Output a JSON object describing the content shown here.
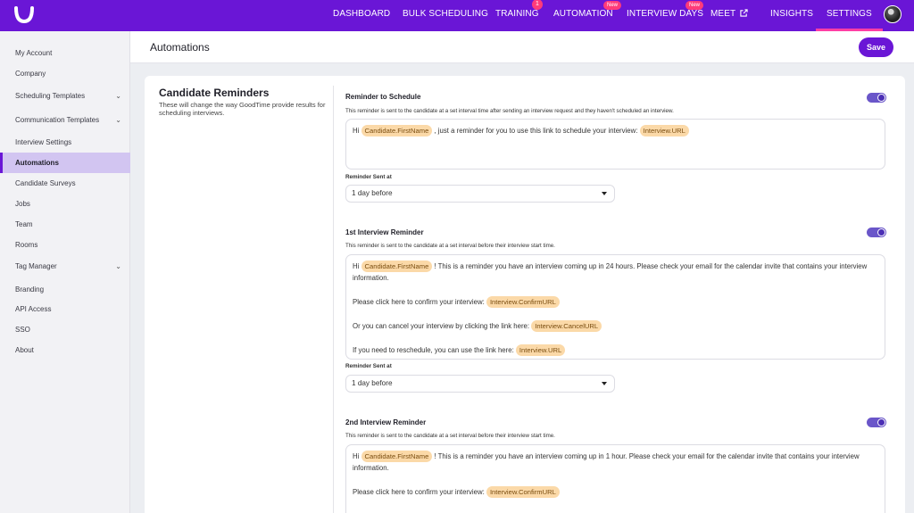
{
  "nav": {
    "items": [
      "DASHBOARD",
      "BULK SCHEDULING",
      "TRAINING",
      "AUTOMATION",
      "INTERVIEW DAYS",
      "MEET",
      "INSIGHTS",
      "SETTINGS"
    ],
    "training_badge": "1",
    "new_badge": "New",
    "active": "SETTINGS"
  },
  "sidebar": {
    "items": [
      {
        "label": "My Account"
      },
      {
        "label": "Company"
      },
      {
        "label": "Scheduling Templates"
      },
      {
        "label": "Communication Templates"
      },
      {
        "label": "Interview Settings"
      },
      {
        "label": "Automations"
      },
      {
        "label": "Candidate Surveys"
      },
      {
        "label": "Jobs"
      },
      {
        "label": "Team"
      },
      {
        "label": "Rooms"
      },
      {
        "label": "Tag Manager"
      },
      {
        "label": "Branding"
      },
      {
        "label": "API Access"
      },
      {
        "label": "SSO"
      },
      {
        "label": "About"
      }
    ]
  },
  "header": {
    "title": "Automations",
    "save_label": "Save"
  },
  "card": {
    "title": "Candidate Reminders",
    "description": "These will change the way GoodTime provide results for scheduling interviews."
  },
  "sections": [
    {
      "title": "Reminder to Schedule",
      "description": "This reminder is sent to the candidate at a set interval time after sending an interview request and they haven't scheduled an interview.",
      "msg": {
        "hi": "Hi",
        "tok_first": "Candidate.FirstName",
        "text1": ", just a reminder for you to use this link to schedule your interview:",
        "tok_url": "Interview.URL"
      },
      "field_label": "Reminder Sent at",
      "select_value": "1 day before"
    },
    {
      "title": "1st Interview Reminder",
      "description": "This reminder is sent to the candidate at a set interval before their interview start time.",
      "msg": {
        "hi": "Hi",
        "tok_first": "Candidate.FirstName",
        "text1": "! This is a reminder you have an interview coming up in 24 hours. Please check your email for the calendar invite that contains your interview information.",
        "confirm_text": "Please click here to confirm your interview:",
        "tok_confirm": "Interview.ConfirmURL",
        "cancel_text": "Or you can cancel your interview by clicking the link here:",
        "tok_cancel": "Interview.CancelURL",
        "resched_text": "If you need to reschedule, you can use the link here:",
        "tok_url": "Interview.URL"
      },
      "field_label": "Reminder Sent at",
      "select_value": "1 day before"
    },
    {
      "title": "2nd Interview Reminder",
      "description": "This reminder is sent to the candidate at a set interval before their interview start time.",
      "msg": {
        "hi": "Hi",
        "tok_first": "Candidate.FirstName",
        "text1": "! This is a reminder you have an interview coming up in 1 hour. Please check your email for the calendar invite that contains your interview information.",
        "confirm_text": "Please click here to confirm your interview:",
        "tok_confirm": "Interview.ConfirmURL"
      }
    }
  ],
  "colors": {
    "brand": "#6a16d6",
    "active_underline": "#ff3ea5",
    "token_bg": "#fbd9a8"
  }
}
